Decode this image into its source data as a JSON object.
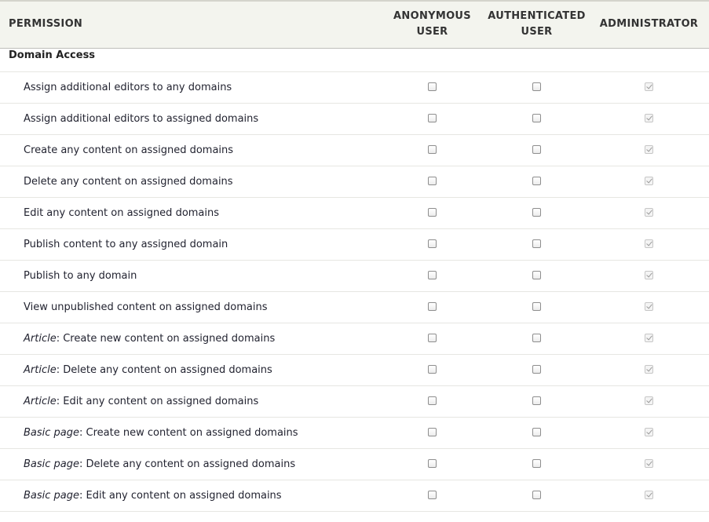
{
  "header": {
    "permission": "PERMISSION",
    "role_anonymous_line1": "ANONYMOUS",
    "role_anonymous_line2": "USER",
    "role_authenticated_line1": "AUTHENTICATED",
    "role_authenticated_line2": "USER",
    "role_administrator": "ADMINISTRATOR"
  },
  "module": {
    "name": "Domain Access"
  },
  "permissions": [
    {
      "prefix": "",
      "label": "Assign additional editors to any domains",
      "anonymous": false,
      "authenticated": false,
      "administrator": true
    },
    {
      "prefix": "",
      "label": "Assign additional editors to assigned domains",
      "anonymous": false,
      "authenticated": false,
      "administrator": true
    },
    {
      "prefix": "",
      "label": "Create any content on assigned domains",
      "anonymous": false,
      "authenticated": false,
      "administrator": true
    },
    {
      "prefix": "",
      "label": "Delete any content on assigned domains",
      "anonymous": false,
      "authenticated": false,
      "administrator": true
    },
    {
      "prefix": "",
      "label": "Edit any content on assigned domains",
      "anonymous": false,
      "authenticated": false,
      "administrator": true
    },
    {
      "prefix": "",
      "label": "Publish content to any assigned domain",
      "anonymous": false,
      "authenticated": false,
      "administrator": true
    },
    {
      "prefix": "",
      "label": "Publish to any domain",
      "anonymous": false,
      "authenticated": false,
      "administrator": true
    },
    {
      "prefix": "",
      "label": "View unpublished content on assigned domains",
      "anonymous": false,
      "authenticated": false,
      "administrator": true
    },
    {
      "prefix": "Article",
      "label": ": Create new content on assigned domains",
      "anonymous": false,
      "authenticated": false,
      "administrator": true
    },
    {
      "prefix": "Article",
      "label": ": Delete any content on assigned domains",
      "anonymous": false,
      "authenticated": false,
      "administrator": true
    },
    {
      "prefix": "Article",
      "label": ": Edit any content on assigned domains",
      "anonymous": false,
      "authenticated": false,
      "administrator": true
    },
    {
      "prefix": "Basic page",
      "label": ": Create new content on assigned domains",
      "anonymous": false,
      "authenticated": false,
      "administrator": true
    },
    {
      "prefix": "Basic page",
      "label": ": Delete any content on assigned domains",
      "anonymous": false,
      "authenticated": false,
      "administrator": true
    },
    {
      "prefix": "Basic page",
      "label": ": Edit any content on assigned domains",
      "anonymous": false,
      "authenticated": false,
      "administrator": true
    }
  ]
}
